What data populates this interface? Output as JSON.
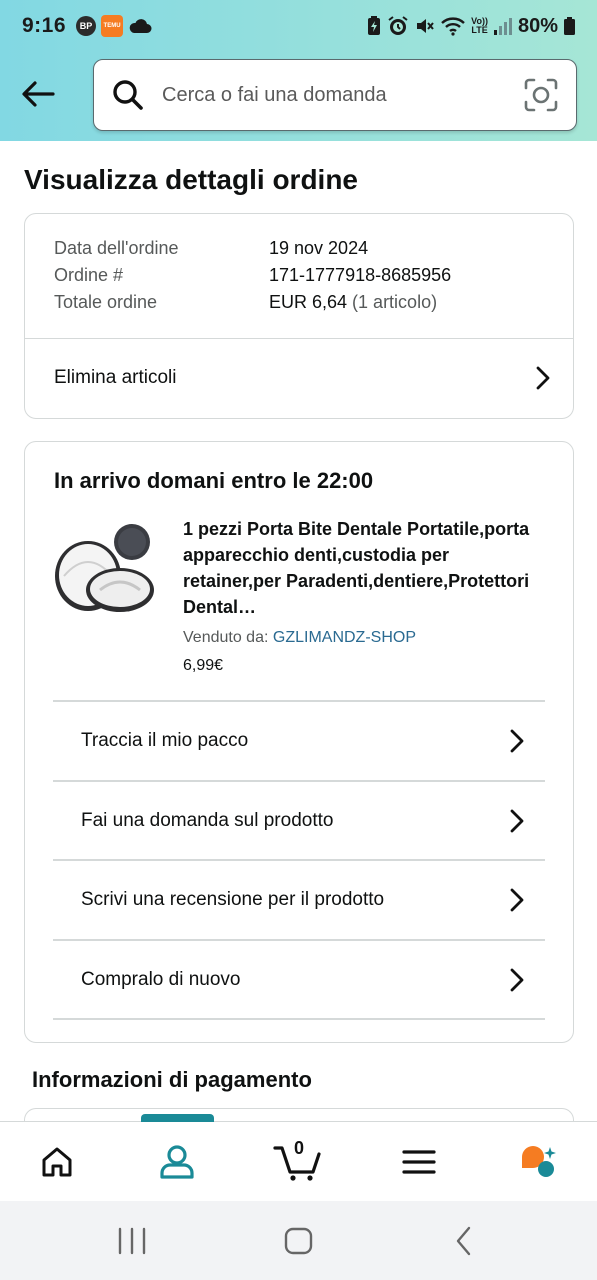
{
  "status_bar": {
    "time": "9:16",
    "bp_badge": "BP",
    "temu_badge": "TEMU",
    "volte_line1": "Vo))",
    "volte_line2": "LTE",
    "battery": "80%"
  },
  "search": {
    "placeholder": "Cerca o fai una domanda"
  },
  "page": {
    "title": "Visualizza dettagli ordine"
  },
  "order_summary": {
    "date_label": "Data dell'ordine",
    "date_value": "19 nov 2024",
    "order_label": "Ordine #",
    "order_value": "171-1777918-8685956",
    "total_label": "Totale ordine",
    "total_value": "EUR 6,64",
    "total_items": "(1 articolo)",
    "delete_items": "Elimina articoli"
  },
  "shipment": {
    "delivery": "In arrivo domani entro le 22:00",
    "product_title": "1 pezzi Porta Bite Dentale Portatile,porta apparecchio denti,custodia per retainer,per Paradenti,dentiere,Protettori Dental…",
    "sold_by_label": "Venduto da:",
    "seller": "GZLIMANDZ-SHOP",
    "price": "6,99€",
    "actions": [
      {
        "label": "Traccia il mio pacco"
      },
      {
        "label": "Fai una domanda sul prodotto"
      },
      {
        "label": "Scrivi una recensione per il prodotto"
      },
      {
        "label": "Compralo di nuovo"
      }
    ]
  },
  "payment": {
    "section_title": "Informazioni di pagamento"
  },
  "bottom_nav": {
    "cart_count": "0",
    "active_tab": "account",
    "accent_color": "#1a8a97",
    "ai_color": "#f57c22"
  }
}
